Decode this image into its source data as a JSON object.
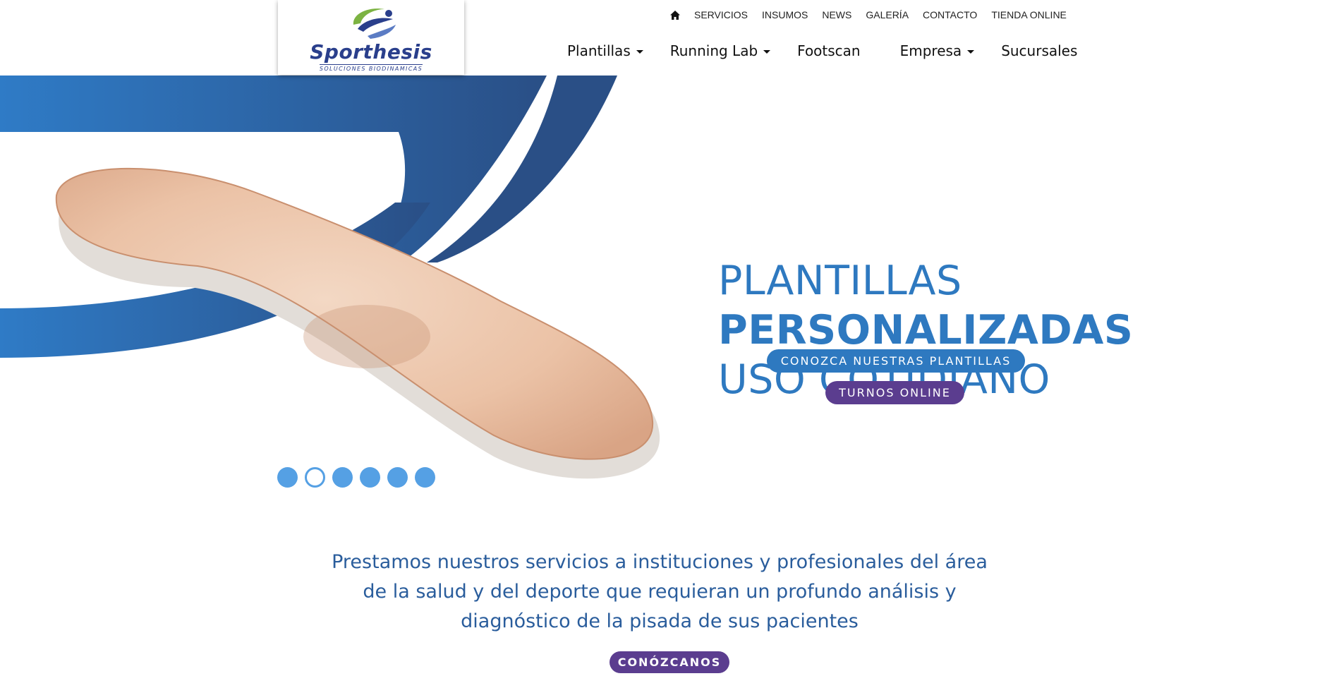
{
  "brand": {
    "name": "Sporthesis",
    "tagline": "SOLUCIONES BIODINAMICAS",
    "colors": {
      "primary": "#2e79c0",
      "dark_blue": "#2a3f8c",
      "purple": "#5b3d8f",
      "green": "#7cb342"
    }
  },
  "top_nav": {
    "home_icon": "home-icon",
    "items": [
      "SERVICIOS",
      "INSUMOS",
      "NEWS",
      "GALERÍA",
      "CONTACTO",
      "TIENDA ONLINE"
    ]
  },
  "main_nav": {
    "items": [
      {
        "label": "Plantillas",
        "dropdown": true
      },
      {
        "label": "Running Lab",
        "dropdown": true
      },
      {
        "label": "Footscan",
        "dropdown": false
      },
      {
        "label": "Empresa",
        "dropdown": true
      },
      {
        "label": "Sucursales",
        "dropdown": false
      }
    ]
  },
  "hero": {
    "line1": "PLANTILLAS",
    "line2": "PERSONALIZADAS",
    "line3": "USO COTIDIANO",
    "cta_primary": "CONOZCA NUESTRAS PLANTILLAS",
    "cta_secondary": "TURNOS ONLINE",
    "slide_count": 6,
    "active_slide": 2
  },
  "intro": {
    "text_line1": "Prestamos nuestros servicios a instituciones y profesionales del área",
    "text_line2": "de la salud y del deporte que requieran un profundo análisis y",
    "text_line3": "diagnóstico de la pisada de sus pacientes",
    "cta": "CONÓZCANOS"
  }
}
